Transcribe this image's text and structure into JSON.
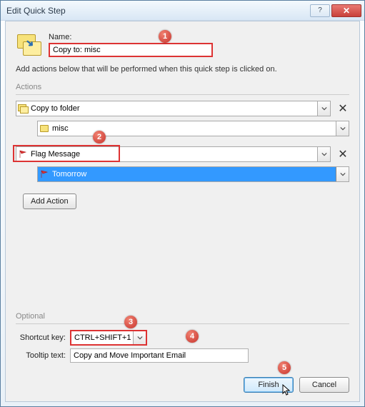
{
  "window": {
    "title": "Edit Quick Step"
  },
  "name": {
    "label": "Name:",
    "value": "Copy to: misc"
  },
  "instruction": "Add actions below that will be performed when this quick step is clicked on.",
  "actions_label": "Actions",
  "actions": {
    "a1": {
      "label": "Copy to folder",
      "sub": "misc"
    },
    "a2": {
      "label": "Flag Message",
      "sub": "Tomorrow"
    }
  },
  "add_action": "Add Action",
  "optional_label": "Optional",
  "shortcut": {
    "label": "Shortcut key:",
    "value": "CTRL+SHIFT+1"
  },
  "tooltip": {
    "label": "Tooltip text:",
    "value": "Copy and Move Important Email"
  },
  "buttons": {
    "finish": "Finish",
    "cancel": "Cancel"
  },
  "bubbles": {
    "b1": "1",
    "b2": "2",
    "b3": "3",
    "b4": "4",
    "b5": "5"
  }
}
